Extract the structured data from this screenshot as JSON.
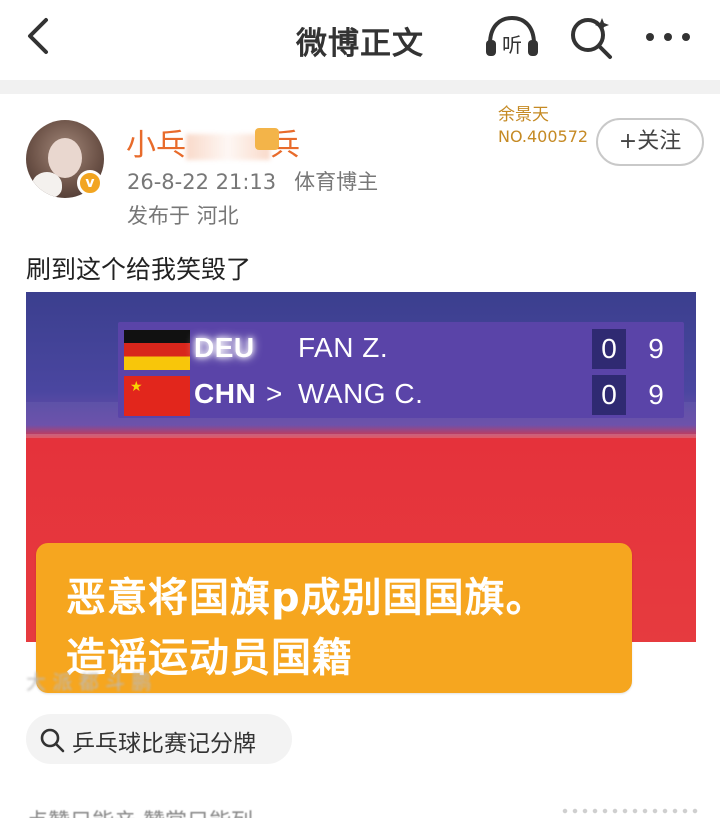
{
  "topbar": {
    "title": "微博正文",
    "back_icon": "chevron-left-icon",
    "listen_label": "听",
    "search_icon": "search-icon",
    "more_icon": "more-icon"
  },
  "post": {
    "author": {
      "name_visible_start": "小乓",
      "name_visible_end": "兵",
      "verified_mark": "v"
    },
    "medal": {
      "name": "余景天",
      "number": "NO.400572"
    },
    "follow_label": "+关注",
    "time": "26-8-22 21:13",
    "role": "体育博主",
    "location": "发布于 河北",
    "text": "刷到这个给我笑毁了"
  },
  "scoreboard": {
    "rows": [
      {
        "country": "DEU",
        "serve": "",
        "player": "FAN Z.",
        "games": "0",
        "points": "9"
      },
      {
        "country": "CHN",
        "serve": ">",
        "player": "WANG C.",
        "games": "0",
        "points": "9"
      }
    ]
  },
  "caption": {
    "line1": "恶意将国旗p成别国国旗。",
    "line2": "造谣运动员国籍"
  },
  "watermark": "大 派 都 斗 鹏",
  "topic": {
    "label": "乒乓球比赛记分牌"
  },
  "footer": {
    "partial_text": "点赞只能亲    赞赏只能列"
  },
  "colors": {
    "accent_orange": "#e86b2b",
    "caption_bg": "#f6a61f",
    "scoreboard_bg": "#5a44a8",
    "table_red": "#e63b3f"
  }
}
